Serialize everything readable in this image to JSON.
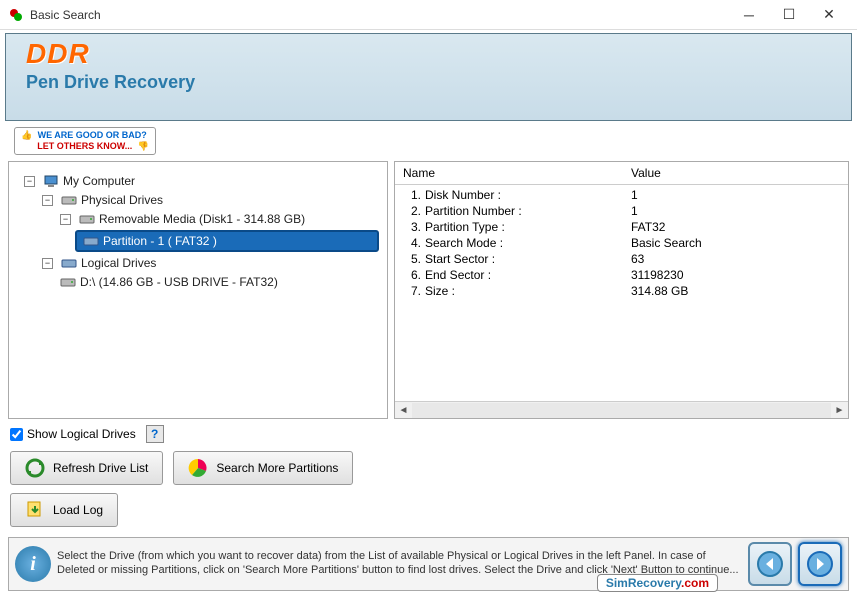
{
  "window": {
    "title": "Basic Search"
  },
  "banner": {
    "brand": "DDR",
    "subtitle": "Pen Drive Recovery"
  },
  "rate": {
    "line1": "WE ARE GOOD OR BAD?",
    "line2": "LET OTHERS KNOW..."
  },
  "tree": {
    "root": "My Computer",
    "physical_label": "Physical Drives",
    "logical_label": "Logical Drives",
    "removable": "Removable Media (Disk1 - 314.88 GB)",
    "partition": "Partition - 1 ( FAT32 )",
    "logical_drive": "D:\\ (14.86 GB - USB DRIVE - FAT32)"
  },
  "details": {
    "columns": {
      "name": "Name",
      "value": "Value"
    },
    "rows": [
      {
        "n": "1.",
        "name": "Disk Number :",
        "value": "1"
      },
      {
        "n": "2.",
        "name": "Partition Number :",
        "value": "1"
      },
      {
        "n": "3.",
        "name": "Partition Type :",
        "value": "FAT32"
      },
      {
        "n": "4.",
        "name": "Search Mode :",
        "value": "Basic Search"
      },
      {
        "n": "5.",
        "name": "Start Sector :",
        "value": "63"
      },
      {
        "n": "6.",
        "name": "End Sector :",
        "value": "31198230"
      },
      {
        "n": "7.",
        "name": "Size :",
        "value": "314.88 GB"
      }
    ]
  },
  "controls": {
    "show_logical": "Show Logical Drives",
    "refresh": "Refresh Drive List",
    "search_more": "Search More Partitions",
    "load_log": "Load Log"
  },
  "footer": {
    "tip": "Select the Drive (from which you want to recover data) from the List of available Physical or Logical Drives in the left Panel. In case of Deleted or missing Partitions, click on 'Search More Partitions' button to find lost drives. Select the Drive and click 'Next' Button to continue...",
    "brand_sim": "SimRecovery",
    "brand_dot": ".com"
  }
}
